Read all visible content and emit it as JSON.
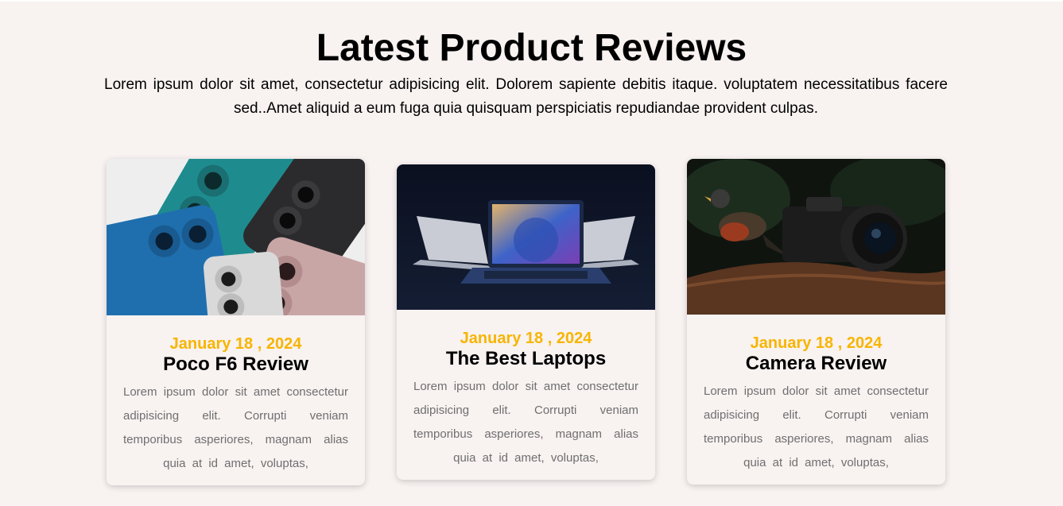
{
  "header": {
    "title": "Latest Product Reviews",
    "subtitle": "Lorem ipsum dolor sit amet, consectetur adipisicing elit. Dolorem sapiente debitis itaque. voluptatem necessitatibus facere sed..Amet aliquid a eum fuga quia quisquam perspiciatis repudiandae provident culpas."
  },
  "cards": [
    {
      "image": "smartphones-image",
      "date": "January 18 , 2024",
      "title": "Poco F6 Review",
      "text": "Lorem ipsum dolor sit amet consectetur adipisicing elit. Corrupti veniam temporibus asperiores, magnam alias quia at id amet, voluptas,"
    },
    {
      "image": "laptops-image",
      "date": "January 18 , 2024",
      "title": "The Best Laptops",
      "text": "Lorem ipsum dolor sit amet consectetur adipisicing elit. Corrupti veniam temporibus asperiores, magnam alias quia at id amet, voluptas,"
    },
    {
      "image": "camera-bird-image",
      "date": "January 18 , 2024",
      "title": "Camera Review",
      "text": "Lorem ipsum dolor sit amet consectetur adipisicing elit. Corrupti veniam temporibus asperiores, magnam alias quia at id amet, voluptas,"
    }
  ],
  "colors": {
    "background": "#f8f2f1",
    "date_accent": "#f7b500",
    "text_gray": "#6f6f6f"
  }
}
